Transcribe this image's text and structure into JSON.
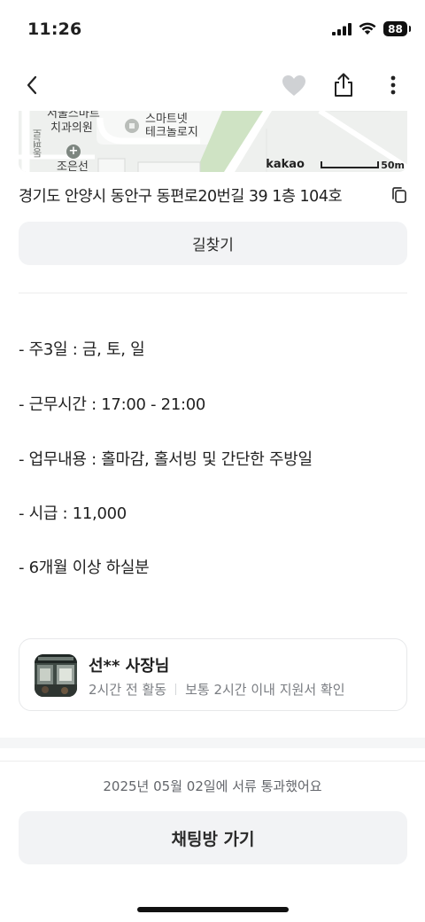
{
  "status": {
    "time": "11:26",
    "battery": "88"
  },
  "nav": {
    "back_icon": "chevron-left-icon",
    "like_icon": "heart-icon",
    "share_icon": "share-icon",
    "more_icon": "more-vertical-icon"
  },
  "map": {
    "labels": [
      "서울스마트",
      "치과의원",
      "스마트넷",
      "테크놀로지",
      "동편로",
      "조은선"
    ],
    "brand": "kakao",
    "scale": "50m",
    "colors": {
      "road": "#ffffff",
      "park": "#cfe3c4",
      "ground": "#eef0ee"
    }
  },
  "address": {
    "text": "경기도 안양시 동안구 동편로20번길 39 1층 104호",
    "copy_icon": "copy-icon"
  },
  "route_button": {
    "label": "길찾기"
  },
  "details": [
    "- 주3일 : 금, 토, 일",
    "- 근무시간 : 17:00 - 21:00",
    "- 업무내용 : 홀마감, 홀서빙 및 간단한 주방일",
    "- 시급 : 11,000",
    "- 6개월 이상 하실분"
  ],
  "owner": {
    "name": "선** 사장님",
    "activity": "2시간 전 활동",
    "response": "보통 2시간 이내 지원서 확인"
  },
  "pass_notice": "2025년 05월 02일에 서류 통과했어요",
  "chat_button": {
    "label": "채팅방 가기"
  }
}
